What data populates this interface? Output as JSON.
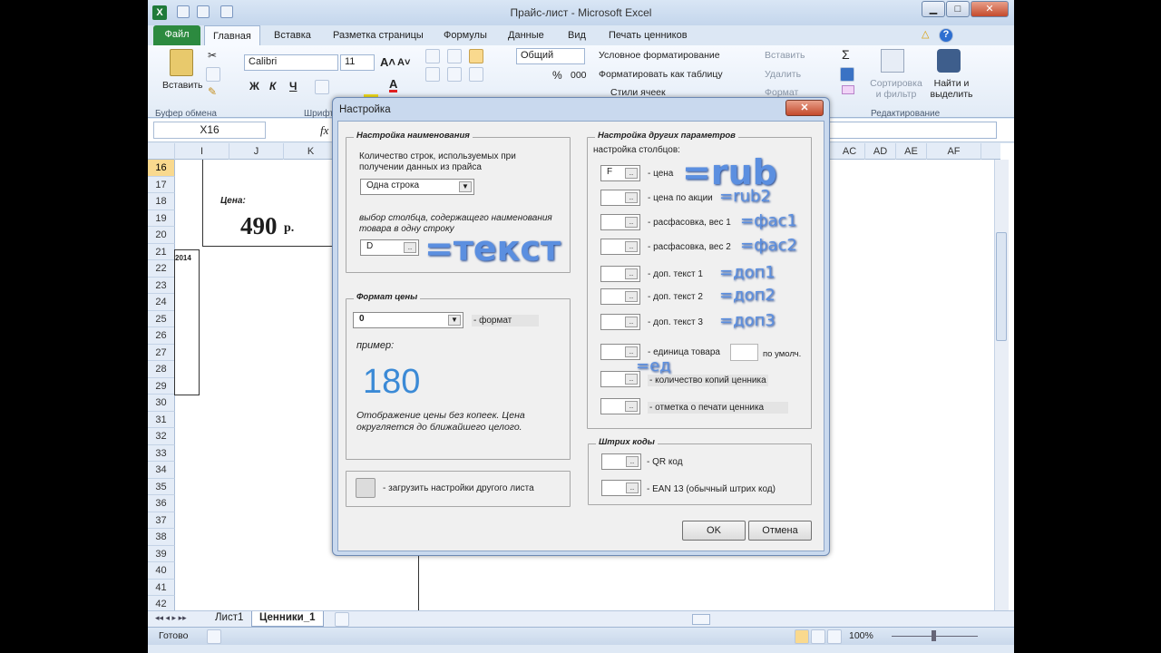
{
  "window": {
    "title": "Прайс-лист  -  Microsoft Excel"
  },
  "ribbon_tabs": [
    "Файл",
    "Главная",
    "Вставка",
    "Разметка страницы",
    "Формулы",
    "Данные",
    "Вид",
    "Печать ценников"
  ],
  "clipboard": {
    "paste": "Вставить",
    "group": "Буфер обмена"
  },
  "font": {
    "name": "Calibri",
    "size": "11",
    "group": "Шрифт",
    "bold": "Ж",
    "italic": "К",
    "underline": "Ч"
  },
  "number": {
    "format": "Общий",
    "percent": "%",
    "thousands": "000"
  },
  "styles": {
    "conditional": "Условное форматирование",
    "as_table": "Форматировать как таблицу",
    "cell_styles": "Стили ячеек"
  },
  "cells": {
    "insert": "Вставить",
    "delete": "Удалить",
    "format": "Формат"
  },
  "editing": {
    "sort": "Сортировка и фильтр",
    "find": "Найти и выделить",
    "group": "Редактирование",
    "sum": "Σ"
  },
  "formula_bar": {
    "name_box": "X16",
    "fx": "fx"
  },
  "columns_left": [
    "I",
    "J",
    "K"
  ],
  "columns_right": [
    "AC",
    "AD",
    "AE",
    "AF"
  ],
  "rows": [
    "16",
    "17",
    "18",
    "19",
    "20",
    "21",
    "22",
    "23",
    "24",
    "25",
    "26",
    "27",
    "28",
    "29",
    "30",
    "31",
    "32",
    "33",
    "34",
    "35",
    "36",
    "37",
    "38",
    "39",
    "40",
    "41",
    "42"
  ],
  "sheet_content": {
    "price_label": "Цена:",
    "price_value": "490",
    "price_unit": "р.",
    "year": "2014"
  },
  "sheet_tabs": [
    "Лист1",
    "Ценники_1"
  ],
  "status": {
    "ready": "Готово",
    "zoom": "100%"
  },
  "dialog": {
    "title": "Настройка",
    "naming": {
      "legend": "Настройка наименования",
      "rows_label": "Количество строк, используемых при получении данных из прайса",
      "rows_value": "Одна строка",
      "col_label": "выбор столбца, содержащего наименования товара в одну строку",
      "col_value": "D",
      "annotation": "=текст"
    },
    "price_format": {
      "legend": "Формат цены",
      "value": "0",
      "format_label": "- формат",
      "example_label": "пример:",
      "example_value": "180",
      "note": "Отображение цены без копеек. Цена округляется до ближайшего целого."
    },
    "load_label": "- загрузить настройки другого листа",
    "other": {
      "legend": "Настройка других параметров",
      "sub": "настройка столбцов:",
      "items": [
        {
          "value": "F",
          "label": "- цена",
          "ann": "=rub"
        },
        {
          "value": "",
          "label": "- цена по акции",
          "ann": "=rub2"
        },
        {
          "value": "",
          "label": "- расфасовка, вес 1",
          "ann": "=фас1"
        },
        {
          "value": "",
          "label": "- расфасовка, вес 2",
          "ann": "=фас2"
        },
        {
          "value": "",
          "label": "- доп. текст 1",
          "ann": "=доп1"
        },
        {
          "value": "",
          "label": "- доп. текст 2",
          "ann": "=доп2"
        },
        {
          "value": "",
          "label": "- доп. текст 3",
          "ann": "=доп3"
        },
        {
          "value": "",
          "label": "- единица товара",
          "ann": "=ед"
        },
        {
          "value": "",
          "label": "- количество копий ценника",
          "ann": ""
        },
        {
          "value": "",
          "label": "- отметка о печати ценника",
          "ann": ""
        }
      ],
      "default_label": "по умолч."
    },
    "barcodes": {
      "legend": "Штрих коды",
      "qr": "- QR код",
      "ean": "- EAN 13 (обычный штрих код)"
    },
    "ok": "OK",
    "cancel": "Отмена"
  }
}
